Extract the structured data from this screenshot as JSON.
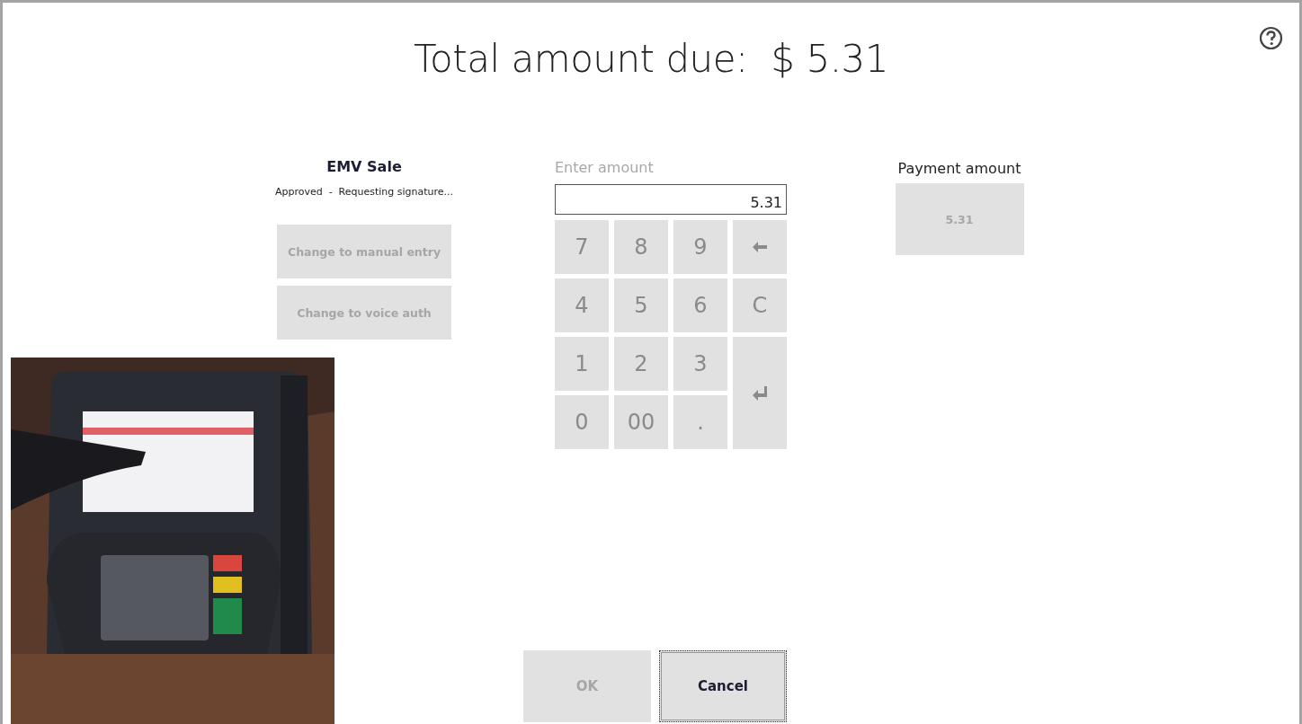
{
  "title": "Total amount due:  $ 5.31",
  "sale": {
    "heading": "EMV Sale",
    "status": "Approved  -  Requesting signature...",
    "buttons": [
      {
        "label": "Change to manual entry",
        "disabled": true
      },
      {
        "label": "Change to voice auth",
        "disabled": true
      }
    ]
  },
  "entry": {
    "label": "Enter amount",
    "value": "5.31",
    "keys": [
      {
        "kind": "digit",
        "label": "7"
      },
      {
        "kind": "digit",
        "label": "8"
      },
      {
        "kind": "digit",
        "label": "9"
      },
      {
        "kind": "backspace"
      },
      {
        "kind": "digit",
        "label": "4"
      },
      {
        "kind": "digit",
        "label": "5"
      },
      {
        "kind": "digit",
        "label": "6"
      },
      {
        "kind": "clear",
        "label": "C"
      },
      {
        "kind": "digit",
        "label": "1"
      },
      {
        "kind": "digit",
        "label": "2"
      },
      {
        "kind": "digit",
        "label": "3"
      },
      {
        "kind": "enter"
      },
      {
        "kind": "digit",
        "label": "0"
      },
      {
        "kind": "digit",
        "label": "00"
      },
      {
        "kind": "digit",
        "label": "."
      }
    ]
  },
  "payment": {
    "label": "Payment amount",
    "amount": "5.31",
    "disabled": true
  },
  "actions": [
    {
      "label": "OK",
      "disabled": true,
      "focused": false
    },
    {
      "label": "Cancel",
      "disabled": false,
      "focused": true
    }
  ]
}
